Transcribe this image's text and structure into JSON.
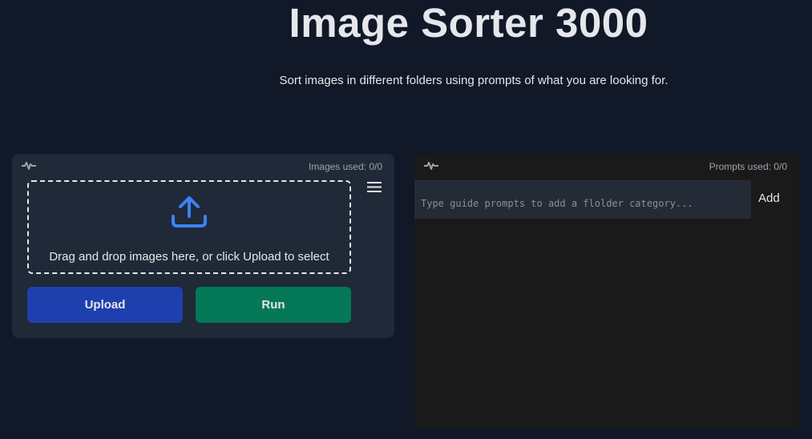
{
  "header": {
    "title": "Image Sorter 3000",
    "subtitle": "Sort images in different folders using prompts of what you are looking for."
  },
  "images_panel": {
    "pulse_icon": "pulse-icon",
    "counter_text": "Images used: 0/0",
    "dropzone": {
      "icon": "upload-icon",
      "text": "Drag and drop images here, or click Upload to select"
    },
    "menu_icon": "hamburger-menu-icon",
    "upload_label": "Upload",
    "run_label": "Run"
  },
  "prompts_panel": {
    "pulse_icon": "pulse-icon",
    "counter_text": "Prompts used: 0/0",
    "input": {
      "value": "",
      "placeholder": "Type guide prompts to add a flolder category..."
    },
    "add_label": "Add"
  },
  "colors": {
    "background": "#111827",
    "left_panel": "#1f2937",
    "right_panel": "#1a1a1a",
    "upload_button": "#1e40af",
    "run_button": "#047857",
    "upload_icon": "#3b82f6",
    "text": "#e5e7eb",
    "muted_text": "#9ca3af"
  }
}
